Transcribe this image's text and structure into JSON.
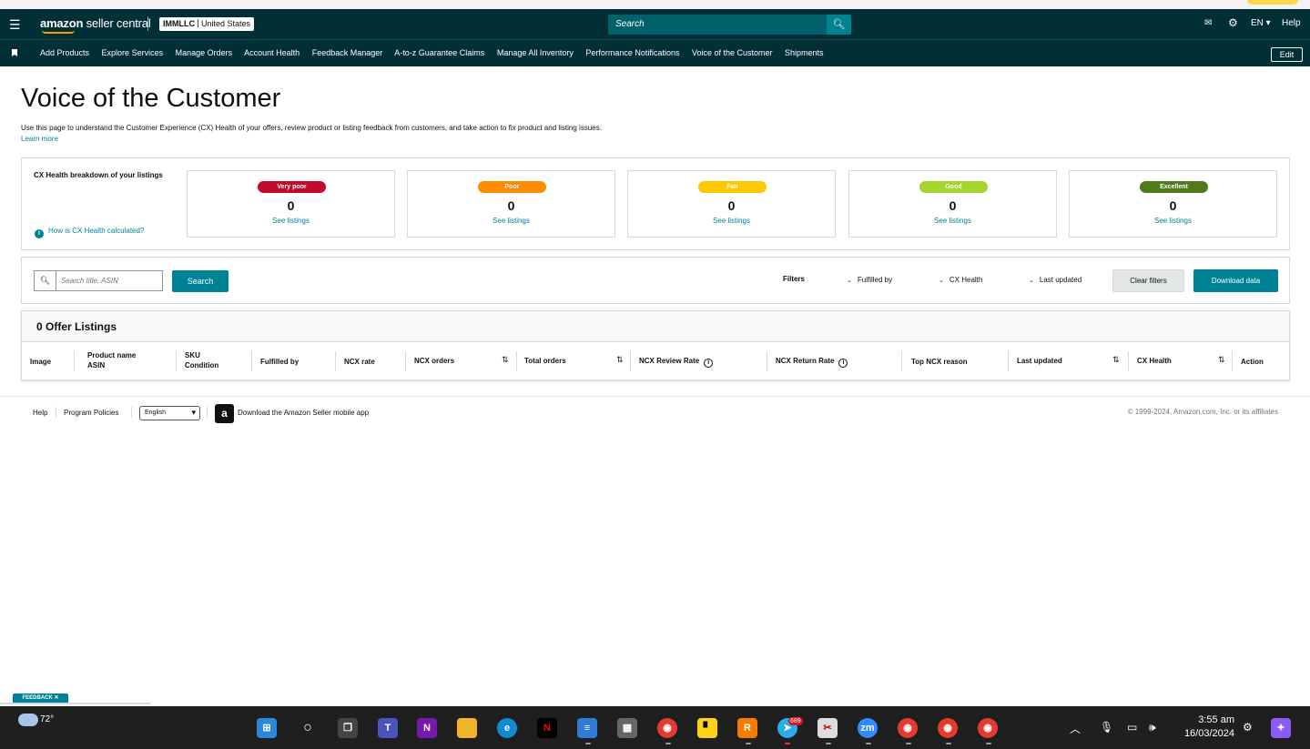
{
  "app": {
    "logo_main": "amazon",
    "logo_sub": " seller central",
    "account_name": "IMMLLC",
    "account_region": "United States",
    "search_placeholder": "Search",
    "lang": "EN",
    "help": "Help"
  },
  "nav": {
    "items": [
      "Add Products",
      "Explore Services",
      "Manage Orders",
      "Account Health",
      "Feedback Manager",
      "A-to-z Guarantee Claims",
      "Manage All Inventory",
      "Performance Notifications",
      "Voice of the Customer",
      "Shipments"
    ],
    "edit": "Edit"
  },
  "page": {
    "title": "Voice of the Customer",
    "description": "Use this page to understand the Customer Experience (CX) Health of your offers, review product or listing feedback from customers, and take action to fix product and listing issues.",
    "learn_more": "Learn more"
  },
  "cx": {
    "label": "CX Health breakdown of your listings",
    "how_link": "How is CX Health calculated?",
    "cards": [
      {
        "label": "Very poor",
        "count": "0",
        "link": "See listings",
        "color": "#c40a2b"
      },
      {
        "label": "Poor",
        "count": "0",
        "link": "See listings",
        "color": "#ff8c00"
      },
      {
        "label": "Fair",
        "count": "0",
        "link": "See listings",
        "color": "#ffc800"
      },
      {
        "label": "Good",
        "count": "0",
        "link": "See listings",
        "color": "#a6d42e"
      },
      {
        "label": "Excellent",
        "count": "0",
        "link": "See listings",
        "color": "#507a1b"
      }
    ]
  },
  "filters": {
    "search_placeholder": "Search title, ASIN",
    "search_button": "Search",
    "label": "Filters",
    "fulfilled_by": "Fulfilled by",
    "cx_health": "CX Health",
    "last_updated": "Last updated",
    "clear": "Clear filters",
    "download": "Download data"
  },
  "table": {
    "title": "0 Offer Listings",
    "headers": {
      "image": "Image",
      "product_name": "Product name",
      "asin": "ASIN",
      "sku": "SKU",
      "condition": "Condition",
      "fulfilled_by": "Fulfilled by",
      "ncx_rate": "NCX rate",
      "ncx_orders": "NCX orders",
      "total_orders": "Total orders",
      "ncx_review_rate": "NCX Review Rate",
      "ncx_return_rate": "NCX Return Rate",
      "top_ncx_reason": "Top NCX reason",
      "last_updated": "Last updated",
      "cx_health": "CX Health",
      "action": "Action"
    }
  },
  "footer": {
    "help": "Help",
    "policies": "Program Policies",
    "language": "English",
    "app_download": "Download the Amazon Seller mobile app",
    "copyright": "© 1999-2024, Amazon.com, Inc. or its affiliates"
  },
  "feedback_tab": "FEEDBACK ✕",
  "taskbar": {
    "temperature": "72°",
    "telegram_badge": "689",
    "time": "3:55 am",
    "date": "16/03/2024"
  }
}
